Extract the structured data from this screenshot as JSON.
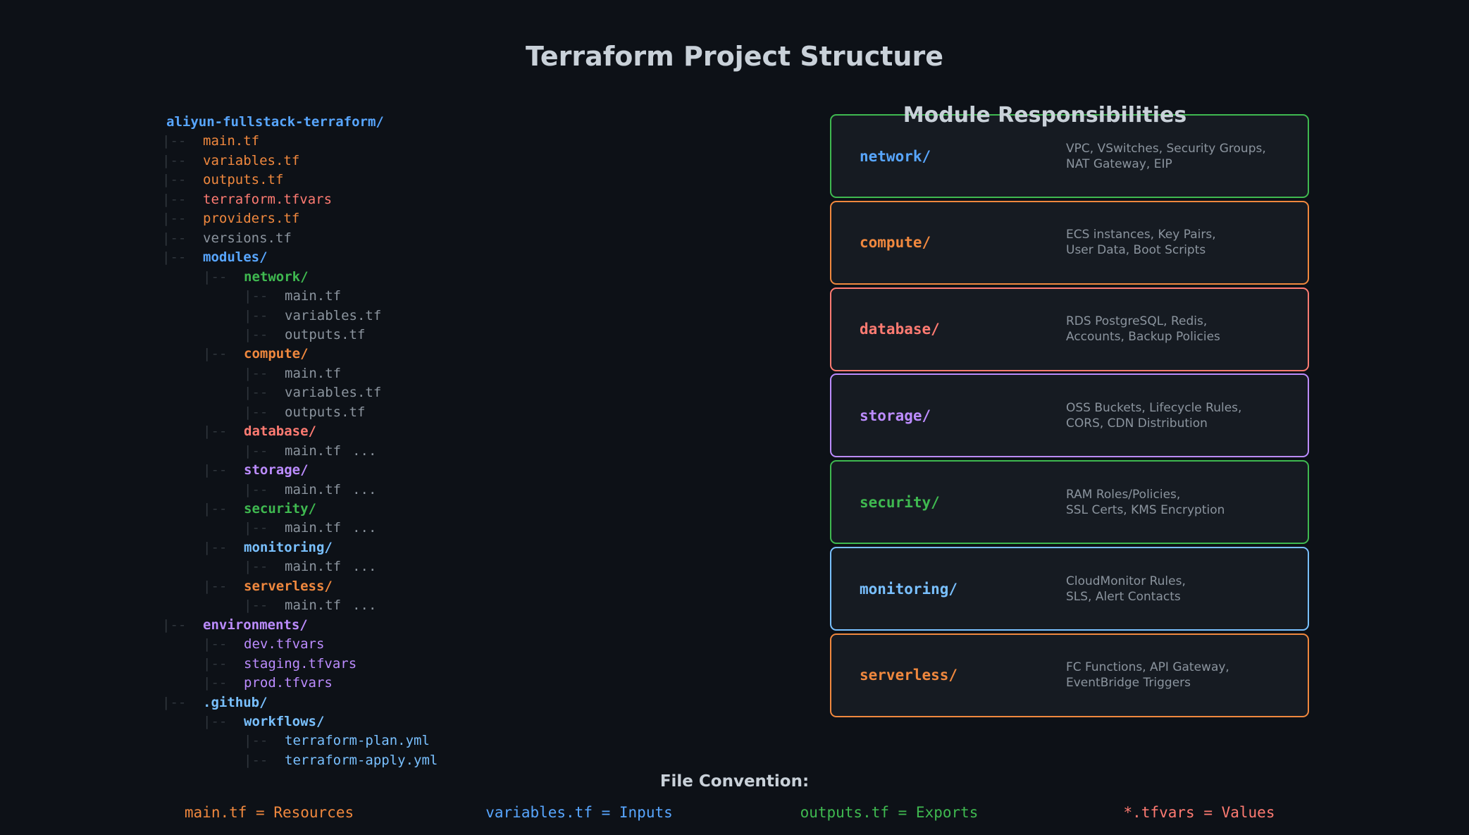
{
  "title": "Terraform Project Structure",
  "tree": {
    "connector": "|--",
    "lines": [
      {
        "text": "aliyun-fullstack-terraform/",
        "depth": -1,
        "color": "#58a6ff",
        "dir": true
      },
      {
        "text": "main.tf",
        "depth": 0,
        "color": "#f0883e"
      },
      {
        "text": "variables.tf",
        "depth": 0,
        "color": "#f0883e"
      },
      {
        "text": "outputs.tf",
        "depth": 0,
        "color": "#f0883e"
      },
      {
        "text": "terraform.tfvars",
        "depth": 0,
        "color": "#ff7b72"
      },
      {
        "text": "providers.tf",
        "depth": 0,
        "color": "#f0883e"
      },
      {
        "text": "versions.tf",
        "depth": 0,
        "color": "#8b949e"
      },
      {
        "text": "modules/",
        "depth": 0,
        "color": "#58a6ff",
        "dir": true
      },
      {
        "text": "network/",
        "depth": 1,
        "color": "#3fb950",
        "dir": true
      },
      {
        "text": "main.tf",
        "depth": 2,
        "color": "#8b949e"
      },
      {
        "text": "variables.tf",
        "depth": 2,
        "color": "#8b949e"
      },
      {
        "text": "outputs.tf",
        "depth": 2,
        "color": "#8b949e"
      },
      {
        "text": "compute/",
        "depth": 1,
        "color": "#f0883e",
        "dir": true
      },
      {
        "text": "main.tf",
        "depth": 2,
        "color": "#8b949e"
      },
      {
        "text": "variables.tf",
        "depth": 2,
        "color": "#8b949e"
      },
      {
        "text": "outputs.tf",
        "depth": 2,
        "color": "#8b949e"
      },
      {
        "text": "database/",
        "depth": 1,
        "color": "#ff7b72",
        "dir": true
      },
      {
        "text": "main.tf",
        "depth": 2,
        "color": "#8b949e",
        "ellipsis": "..."
      },
      {
        "text": "storage/",
        "depth": 1,
        "color": "#bc8cff",
        "dir": true
      },
      {
        "text": "main.tf",
        "depth": 2,
        "color": "#8b949e",
        "ellipsis": "..."
      },
      {
        "text": "security/",
        "depth": 1,
        "color": "#3fb950",
        "dir": true
      },
      {
        "text": "main.tf",
        "depth": 2,
        "color": "#8b949e",
        "ellipsis": "..."
      },
      {
        "text": "monitoring/",
        "depth": 1,
        "color": "#79c0ff",
        "dir": true
      },
      {
        "text": "main.tf",
        "depth": 2,
        "color": "#8b949e",
        "ellipsis": "..."
      },
      {
        "text": "serverless/",
        "depth": 1,
        "color": "#f0883e",
        "dir": true
      },
      {
        "text": "main.tf",
        "depth": 2,
        "color": "#8b949e",
        "ellipsis": "..."
      },
      {
        "text": "environments/",
        "depth": 0,
        "color": "#bc8cff",
        "dir": true
      },
      {
        "text": "dev.tfvars",
        "depth": 1,
        "color": "#bc8cff"
      },
      {
        "text": "staging.tfvars",
        "depth": 1,
        "color": "#bc8cff"
      },
      {
        "text": "prod.tfvars",
        "depth": 1,
        "color": "#bc8cff"
      },
      {
        "text": ".github/",
        "depth": 0,
        "color": "#79c0ff",
        "dir": true
      },
      {
        "text": "workflows/",
        "depth": 1,
        "color": "#79c0ff",
        "dir": true
      },
      {
        "text": "terraform-plan.yml",
        "depth": 2,
        "color": "#79c0ff"
      },
      {
        "text": "terraform-apply.yml",
        "depth": 2,
        "color": "#79c0ff"
      }
    ]
  },
  "responsibilities": {
    "title": "Module Responsibilities",
    "modules": [
      {
        "name": "network/",
        "color": "#3fb950",
        "text_color": "#58a6ff",
        "desc": [
          "VPC, VSwitches, Security Groups,",
          "NAT Gateway, EIP"
        ]
      },
      {
        "name": "compute/",
        "color": "#f0883e",
        "text_color": "#f0883e",
        "desc": [
          "ECS instances, Key Pairs,",
          "User Data, Boot Scripts"
        ]
      },
      {
        "name": "database/",
        "color": "#ff7b72",
        "text_color": "#ff7b72",
        "desc": [
          "RDS PostgreSQL, Redis,",
          "Accounts, Backup Policies"
        ]
      },
      {
        "name": "storage/",
        "color": "#bc8cff",
        "text_color": "#bc8cff",
        "desc": [
          "OSS Buckets, Lifecycle Rules,",
          "CORS, CDN Distribution"
        ]
      },
      {
        "name": "security/",
        "color": "#3fb950",
        "text_color": "#3fb950",
        "desc": [
          "RAM Roles/Policies,",
          "SSL Certs, KMS Encryption"
        ]
      },
      {
        "name": "monitoring/",
        "color": "#79c0ff",
        "text_color": "#79c0ff",
        "desc": [
          "CloudMonitor Rules,",
          "SLS, Alert Contacts"
        ]
      },
      {
        "name": "serverless/",
        "color": "#f0883e",
        "text_color": "#f0883e",
        "desc": [
          "FC Functions, API Gateway,",
          "EventBridge Triggers"
        ]
      }
    ]
  },
  "convention": {
    "title": "File Convention:",
    "items": [
      {
        "text": "main.tf = Resources",
        "color": "#f0883e"
      },
      {
        "text": "variables.tf = Inputs",
        "color": "#58a6ff"
      },
      {
        "text": "outputs.tf = Exports",
        "color": "#3fb950"
      },
      {
        "text": "*.tfvars = Values",
        "color": "#ff7b72"
      }
    ]
  }
}
